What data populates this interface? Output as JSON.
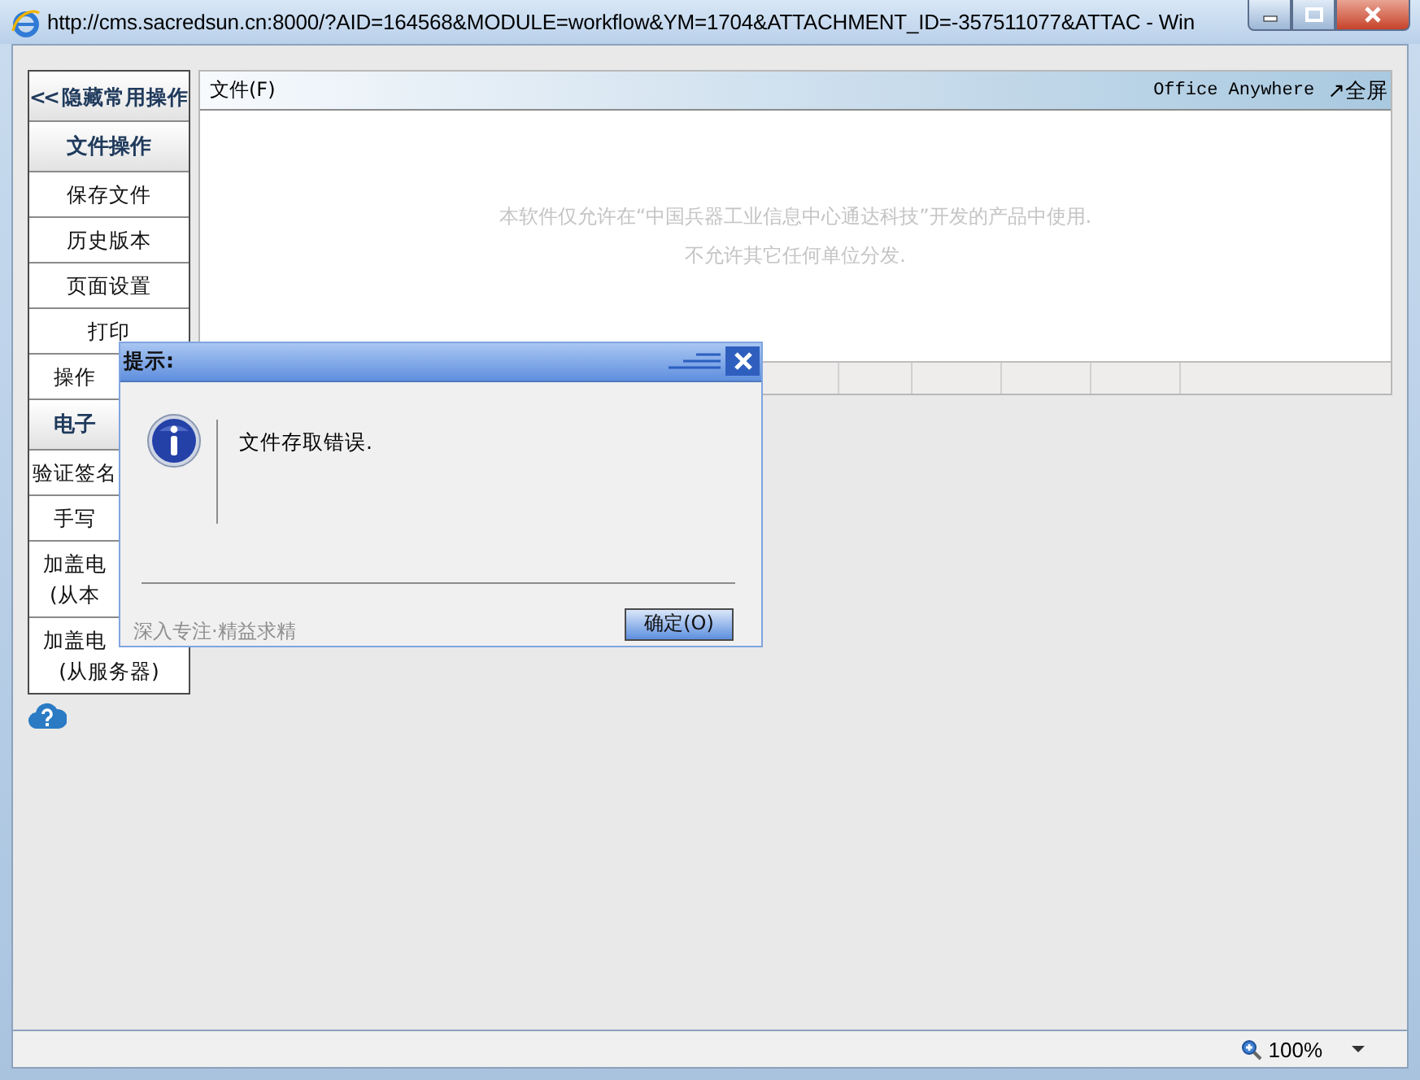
{
  "window": {
    "title": "http://cms.sacredsun.cn:8000/?AID=164568&MODULE=workflow&YM=1704&ATTACHMENT_ID=-357511077&ATTAC - Win"
  },
  "sidebar": {
    "items": [
      {
        "kind": "toggle",
        "chevron": "<<",
        "lines": [
          "隐藏常用操作"
        ]
      },
      {
        "kind": "header",
        "lines": [
          "文件操作"
        ]
      },
      {
        "kind": "item",
        "lines": [
          "保存文件"
        ]
      },
      {
        "kind": "item",
        "lines": [
          "历史版本"
        ]
      },
      {
        "kind": "item",
        "lines": [
          "页面设置"
        ]
      },
      {
        "kind": "item",
        "lines": [
          "打印"
        ]
      },
      {
        "kind": "item",
        "lines": [
          "操作"
        ]
      },
      {
        "kind": "header",
        "lines": [
          "电子"
        ]
      },
      {
        "kind": "item",
        "lines": [
          "验证签名"
        ]
      },
      {
        "kind": "item",
        "lines": [
          "手写"
        ]
      },
      {
        "kind": "item",
        "lines": [
          "加盖电",
          "(从本"
        ]
      },
      {
        "kind": "item",
        "lines": [
          "加盖电",
          "(从服务器)"
        ]
      }
    ]
  },
  "document": {
    "menu": "文件(F)",
    "brand": "Office Anywhere",
    "fullscreen": "↗全屏",
    "notice": [
      "本软件仅允许在“中国兵器工业信息中心通达科技”开发的产品中使用.",
      "不允许其它任何单位分发."
    ]
  },
  "dialog": {
    "title": "提示:",
    "message": "文件存取错误.",
    "slogan": "深入专注·精益求精",
    "button": "确定(O)"
  },
  "status_bar": {
    "zoom": "100%"
  }
}
